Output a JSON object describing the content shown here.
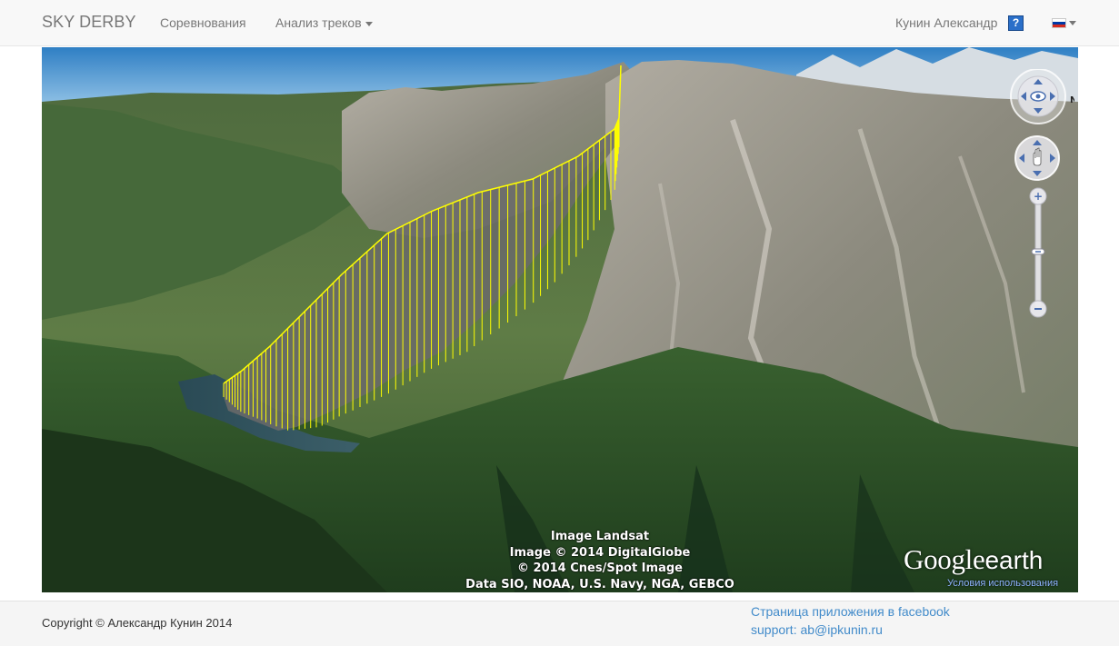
{
  "navbar": {
    "brand": "SKY DERBY",
    "links": [
      {
        "label": "Соревнования"
      },
      {
        "label": "Анализ треков"
      }
    ],
    "user_name": "Кунин Александр",
    "help_label": "?"
  },
  "map": {
    "attribution": [
      "Image Landsat",
      "Image © 2014 DigitalGlobe",
      "© 2014 Cnes/Spot Image",
      "Data SIO, NOAA, U.S. Navy, NGA, GEBCO"
    ],
    "logo_google": "Google",
    "logo_earth": "earth",
    "terms_label": "Условия использования",
    "track_color": "#ffff00"
  },
  "footer": {
    "copyright": "Copyright © Александр Кунин 2014",
    "facebook_link": "Страница приложения в facebook",
    "support_link": "support: ab@ipkunin.ru"
  },
  "colors": {
    "link": "#428bca",
    "navbar_text": "#777777",
    "help_icon_bg": "#2a6fc9"
  }
}
